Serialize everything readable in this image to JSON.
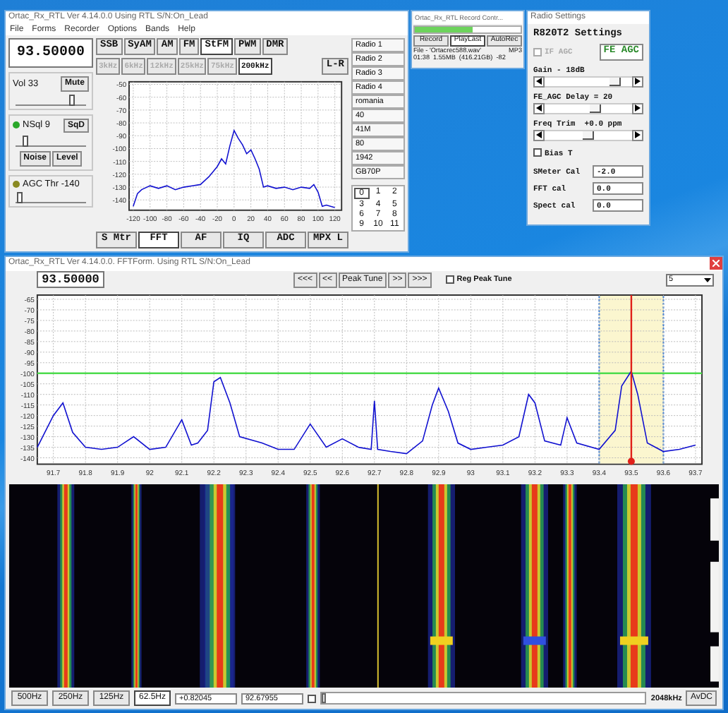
{
  "main_window": {
    "title": "Ortac_Rx_RTL Ver 4.14.0.0  Using RTL  S/N:On_Lead",
    "menu": [
      "File",
      "Forms",
      "Recorder",
      "Options",
      "Bands",
      "Help"
    ],
    "frequency": "93.50000",
    "volume": {
      "label": "Vol 33",
      "button": "Mute",
      "level": 0.85
    },
    "squelch": {
      "label": "NSql 9",
      "indicator_on": true,
      "button": "SqD",
      "level": 0.12
    },
    "noise_buttons": [
      "Noise",
      "Level"
    ],
    "agc": {
      "label": "AGC Thr -140",
      "indicator_on": false,
      "level": 0.03
    },
    "modes": [
      {
        "label": "SSB",
        "selected": false
      },
      {
        "label": "SyAM",
        "selected": false
      },
      {
        "label": "AM",
        "selected": false
      },
      {
        "label": "FM",
        "selected": false
      },
      {
        "label": "StFM",
        "selected": true
      },
      {
        "label": "PWM",
        "selected": false
      },
      {
        "label": "DMR",
        "selected": false
      }
    ],
    "bandwidths": [
      {
        "label": "3kHz",
        "selected": false,
        "disabled": true
      },
      {
        "label": "6kHz",
        "selected": false,
        "disabled": true
      },
      {
        "label": "12kHz",
        "selected": false,
        "disabled": true
      },
      {
        "label": "25kHz",
        "selected": false,
        "disabled": true
      },
      {
        "label": "75kHz",
        "selected": false,
        "disabled": true
      },
      {
        "label": "200kHz",
        "selected": true,
        "disabled": false
      }
    ],
    "stereo_button": "L-R",
    "chart_data": {
      "type": "line",
      "x": [
        -120,
        -115,
        -110,
        -100,
        -90,
        -80,
        -70,
        -60,
        -50,
        -40,
        -30,
        -20,
        -15,
        -10,
        -5,
        0,
        5,
        10,
        15,
        20,
        25,
        30,
        35,
        40,
        50,
        60,
        70,
        80,
        90,
        95,
        100,
        105,
        110,
        120
      ],
      "series": [
        {
          "color": "#1010d0",
          "values": [
            -145,
            -135,
            -132,
            -129,
            -131,
            -129,
            -132,
            -130,
            -129,
            -128,
            -122,
            -114,
            -108,
            -112,
            -98,
            -86,
            -92,
            -97,
            -104,
            -101,
            -108,
            -116,
            -130,
            -129,
            -131,
            -130,
            -132,
            -130,
            -131,
            -128,
            -134,
            -145,
            -144,
            -146
          ]
        }
      ],
      "grid": true,
      "xlim": [
        -125,
        128
      ],
      "ylim": [
        -148,
        -48
      ],
      "xticks": [
        -120,
        -100,
        -80,
        -60,
        -40,
        -20,
        0,
        20,
        40,
        60,
        80,
        100,
        120
      ],
      "yticks": [
        -50,
        -60,
        -70,
        -80,
        -90,
        -100,
        -110,
        -120,
        -130,
        -140
      ]
    },
    "tabs": [
      {
        "label": "S Mtr",
        "selected": false
      },
      {
        "label": "FFT",
        "selected": true
      },
      {
        "label": "AF",
        "selected": false
      },
      {
        "label": "IQ",
        "selected": false
      },
      {
        "label": "ADC",
        "selected": false
      },
      {
        "label": "MPX L",
        "selected": false
      }
    ],
    "presets": [
      "Radio 1",
      "Radio 2",
      "Radio 3",
      "Radio 4",
      "romania",
      "40",
      "41M",
      "80",
      "1942",
      "GB70P"
    ],
    "number_grid": [
      {
        "label": "0",
        "selected": true
      },
      {
        "label": "1",
        "selected": false
      },
      {
        "label": "2",
        "selected": false
      },
      {
        "label": "3",
        "selected": false
      },
      {
        "label": "4",
        "selected": false
      },
      {
        "label": "5",
        "selected": false
      },
      {
        "label": "6",
        "selected": false
      },
      {
        "label": "7",
        "selected": false
      },
      {
        "label": "8",
        "selected": false
      },
      {
        "label": "9",
        "selected": false
      },
      {
        "label": "10",
        "selected": false
      },
      {
        "label": "11",
        "selected": false
      }
    ]
  },
  "record_window": {
    "title": "Ortac_Rx_RTL Record Contr...",
    "level": 0.55,
    "buttons": [
      {
        "label": "Record",
        "selected": false
      },
      {
        "label": "PlayLast",
        "selected": true
      },
      {
        "label": "AutoRec",
        "selected": false
      }
    ],
    "file": "File - 'Ortacrec588.wav'",
    "format": "MP3",
    "status": "01:38  1.55MB  (416.21GB)  -82"
  },
  "radio_settings": {
    "title": "Radio Settings",
    "group": "R820T2 Settings",
    "if_agc": {
      "label": "IF AGC",
      "checked": false,
      "disabled": true
    },
    "fe_agc_button": "FE AGC",
    "sliders": [
      {
        "label": "Gain - 18dB",
        "level": 0.85
      },
      {
        "label": "FE_AGC Delay = 20",
        "level": 0.58
      },
      {
        "label": "Freq Trim  +0.0 ppm",
        "level": 0.5
      }
    ],
    "bias_t": {
      "label": "Bias T",
      "checked": false
    },
    "fields": [
      {
        "label": "SMeter Cal",
        "value": "-2.0"
      },
      {
        "label": "FFT cal",
        "value": "0.0"
      },
      {
        "label": "Spect cal",
        "value": "0.0"
      }
    ]
  },
  "fft_window": {
    "title": "Ortac_Rx_RTL Ver 4.14.0.0. FFTForm. Using RTL  S/N:On_Lead",
    "frequency": "93.50000",
    "nav_buttons": [
      "<<<",
      "<<",
      "Peak Tune",
      ">>",
      ">>>"
    ],
    "reg_peak_tune": {
      "label": "Reg Peak Tune",
      "checked": false
    },
    "dropdown": "5",
    "chart_data": {
      "type": "line",
      "x": [
        91.65,
        91.7,
        91.73,
        91.76,
        91.8,
        91.85,
        91.9,
        91.95,
        92.0,
        92.05,
        92.1,
        92.13,
        92.15,
        92.18,
        92.2,
        92.22,
        92.25,
        92.28,
        92.35,
        92.4,
        92.45,
        92.5,
        92.55,
        92.6,
        92.65,
        92.69,
        92.7,
        92.71,
        92.75,
        92.8,
        92.85,
        92.88,
        92.9,
        92.93,
        92.96,
        93.0,
        93.05,
        93.1,
        93.15,
        93.18,
        93.2,
        93.23,
        93.28,
        93.3,
        93.33,
        93.4,
        93.45,
        93.47,
        93.5,
        93.52,
        93.55,
        93.6,
        93.65,
        93.7
      ],
      "series": [
        {
          "color": "#1010d0",
          "values": [
            -135,
            -120,
            -114,
            -128,
            -135,
            -136,
            -135,
            -130,
            -136,
            -135,
            -122,
            -134,
            -133,
            -127,
            -104,
            -102,
            -114,
            -130,
            -133,
            -136,
            -136,
            -124,
            -135,
            -131,
            -135,
            -136,
            -113,
            -136,
            -137,
            -138,
            -132,
            -115,
            -107,
            -118,
            -133,
            -136,
            -135,
            -134,
            -130,
            -110,
            -114,
            -132,
            -134,
            -121,
            -133,
            -136,
            -127,
            -106,
            -99,
            -110,
            -133,
            -137,
            -136,
            -134
          ]
        }
      ],
      "grid": true,
      "bands": [
        {
          "axis": "x",
          "from": 93.4,
          "to": 93.6,
          "color": "#fbf6cf"
        }
      ],
      "ref_lines": [
        {
          "axis": "y",
          "value": -100,
          "color": "#4ddc4d"
        },
        {
          "axis": "x",
          "value": 93.5,
          "color": "#e0201a"
        }
      ],
      "xlim": [
        91.65,
        93.72
      ],
      "ylim": [
        -143,
        -63
      ],
      "xticks": [
        91.7,
        91.8,
        91.9,
        92,
        92.1,
        92.2,
        92.3,
        92.4,
        92.5,
        92.6,
        92.7,
        92.8,
        92.9,
        93,
        93.1,
        93.2,
        93.3,
        93.4,
        93.5,
        93.6,
        93.7
      ],
      "yticks": [
        -65,
        -70,
        -75,
        -80,
        -85,
        -90,
        -95,
        -100,
        -105,
        -110,
        -115,
        -120,
        -125,
        -130,
        -135,
        -140
      ]
    },
    "spans": [
      {
        "label": "500Hz",
        "selected": false
      },
      {
        "label": "250Hz",
        "selected": false
      },
      {
        "label": "125Hz",
        "selected": false
      },
      {
        "label": "62.5Hz",
        "selected": true
      }
    ],
    "offset": "+0.82045",
    "start_frequency": "92.67955",
    "lock_checked": false,
    "scroll_slider": {
      "level": 0.0
    },
    "sample_rate": "2048kHz",
    "avdc_button": "AvDC"
  }
}
